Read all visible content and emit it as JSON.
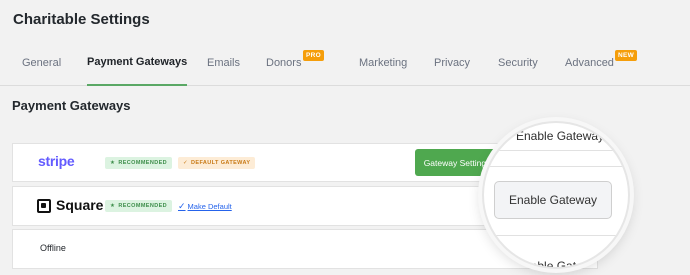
{
  "page": {
    "title": "Charitable Settings"
  },
  "tabs": [
    {
      "label": "General",
      "active": false
    },
    {
      "label": "Payment Gateways",
      "active": true
    },
    {
      "label": "Emails",
      "active": false
    },
    {
      "label": "Donors",
      "active": false,
      "badge": "PRO"
    },
    {
      "label": "Marketing",
      "active": false
    },
    {
      "label": "Privacy",
      "active": false
    },
    {
      "label": "Security",
      "active": false
    },
    {
      "label": "Advanced",
      "active": false,
      "badge": "NEW"
    }
  ],
  "section": {
    "title": "Payment Gateways"
  },
  "gateways": {
    "stripe": {
      "logo": "stripe",
      "badge_recommended": "RECOMMENDED",
      "badge_default": "DEFAULT GATEWAY",
      "settings_button": "Gateway Settings"
    },
    "square": {
      "logo": "Square",
      "badge_recommended": "RECOMMENDED",
      "make_default": "Make Default"
    },
    "offline": {
      "label": "Offline"
    }
  },
  "magnifier": {
    "top_text": "Enable Gateway",
    "button": "Enable Gateway",
    "bottom_text": "Enable Gateway"
  },
  "colors": {
    "accent_green": "#4fa84f",
    "stripe_purple": "#635bff",
    "badge_orange": "#f59e0b",
    "link_blue": "#2563eb"
  }
}
